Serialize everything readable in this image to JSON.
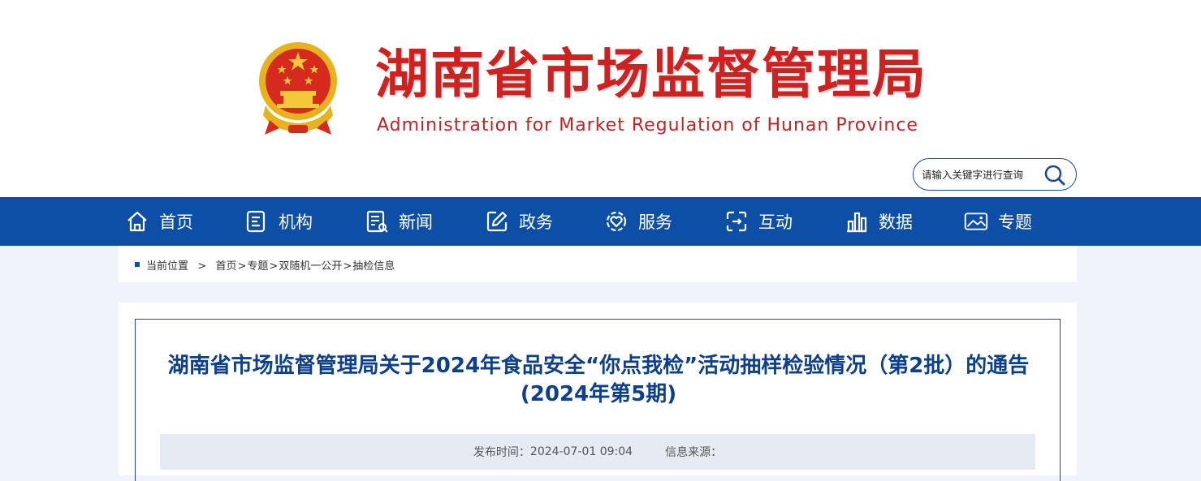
{
  "header": {
    "title_cn": "湖南省市场监督管理局",
    "title_en": "Administration for Market Regulation of Hunan Province",
    "emblem_icon": "national-emblem-icon"
  },
  "search": {
    "placeholder": "请输入关键字进行查询",
    "icon": "search-icon"
  },
  "nav": {
    "items": [
      {
        "label": "首页",
        "icon": "home-icon"
      },
      {
        "label": "机构",
        "icon": "organization-icon"
      },
      {
        "label": "新闻",
        "icon": "news-icon"
      },
      {
        "label": "政务",
        "icon": "edit-icon"
      },
      {
        "label": "服务",
        "icon": "service-icon"
      },
      {
        "label": "互动",
        "icon": "interaction-icon"
      },
      {
        "label": "数据",
        "icon": "data-chart-icon"
      },
      {
        "label": "专题",
        "icon": "image-icon"
      }
    ]
  },
  "breadcrumb": {
    "prefix": "当前位置",
    "separator": ">",
    "items": [
      "首页",
      "专题",
      "双随机一公开",
      "抽检信息"
    ]
  },
  "article": {
    "title_line1": "湖南省市场监督管理局关于2024年食品安全“你点我检”活动抽样检验情况（第2批）的通告",
    "title_line2": "(2024年第5期)",
    "publish_label": "发布时间：",
    "publish_time": "2024-07-01 09:04",
    "source_label": "信息来源："
  },
  "colors": {
    "brand_red": "#d0201f",
    "nav_blue": "#0d4ea6",
    "title_blue": "#0d3f8f",
    "page_bg": "#f0f3fa"
  }
}
